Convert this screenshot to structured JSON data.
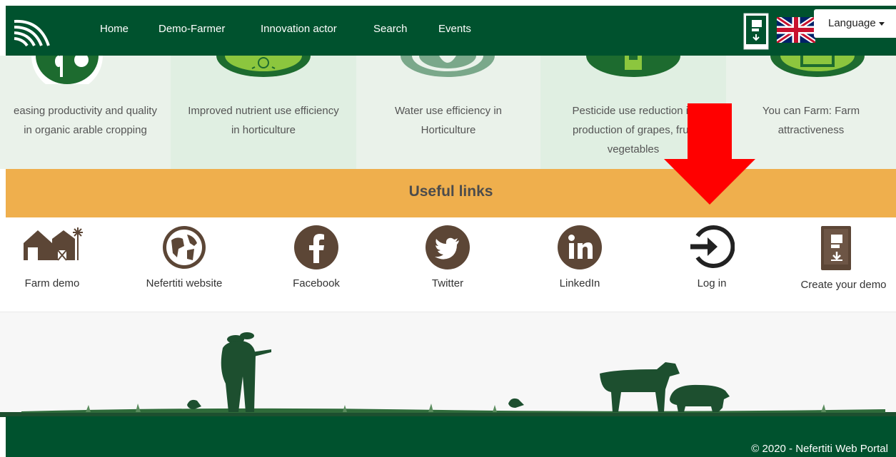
{
  "nav": {
    "links": [
      "Home",
      "Demo-Farmer",
      "Innovation actor",
      "Search",
      "Events"
    ],
    "language_label": "Language",
    "logo_icon": "wifi-signal-logo",
    "create_icon": "create-demo-book-icon",
    "flag_icon": "uk-flag-icon"
  },
  "topics": [
    {
      "line1": "easing productivity and quality",
      "line2": "in organic arable cropping",
      "line3": ""
    },
    {
      "line1": "Improved nutrient use efficiency",
      "line2": "in horticulture",
      "line3": ""
    },
    {
      "line1": "Water use efficiency in",
      "line2": "Horticulture",
      "line3": ""
    },
    {
      "line1": "Pesticide use reduction in",
      "line2": "production of grapes, fruit",
      "line3": "vegetables"
    },
    {
      "line1": "You can Farm: Farm",
      "line2": "attractiveness",
      "line3": ""
    }
  ],
  "useful_links": {
    "title": "Useful links",
    "items": [
      {
        "label": "Farm demo",
        "icon": "farm-icon"
      },
      {
        "label": "Nefertiti website",
        "icon": "globe-icon"
      },
      {
        "label": "Facebook",
        "icon": "facebook-icon"
      },
      {
        "label": "Twitter",
        "icon": "twitter-icon"
      },
      {
        "label": "LinkedIn",
        "icon": "linkedin-icon"
      },
      {
        "label": "Log in",
        "icon": "login-icon"
      },
      {
        "label": "Create your demo",
        "icon": "create-demo-icon"
      }
    ]
  },
  "footer": {
    "copyright": "© 2020 - Nefertiti Web Portal"
  },
  "colors": {
    "primary_green": "#00522e",
    "accent_orange": "#efaf4d",
    "icon_brown": "#5c4636",
    "annotation_red": "#ff0000"
  }
}
